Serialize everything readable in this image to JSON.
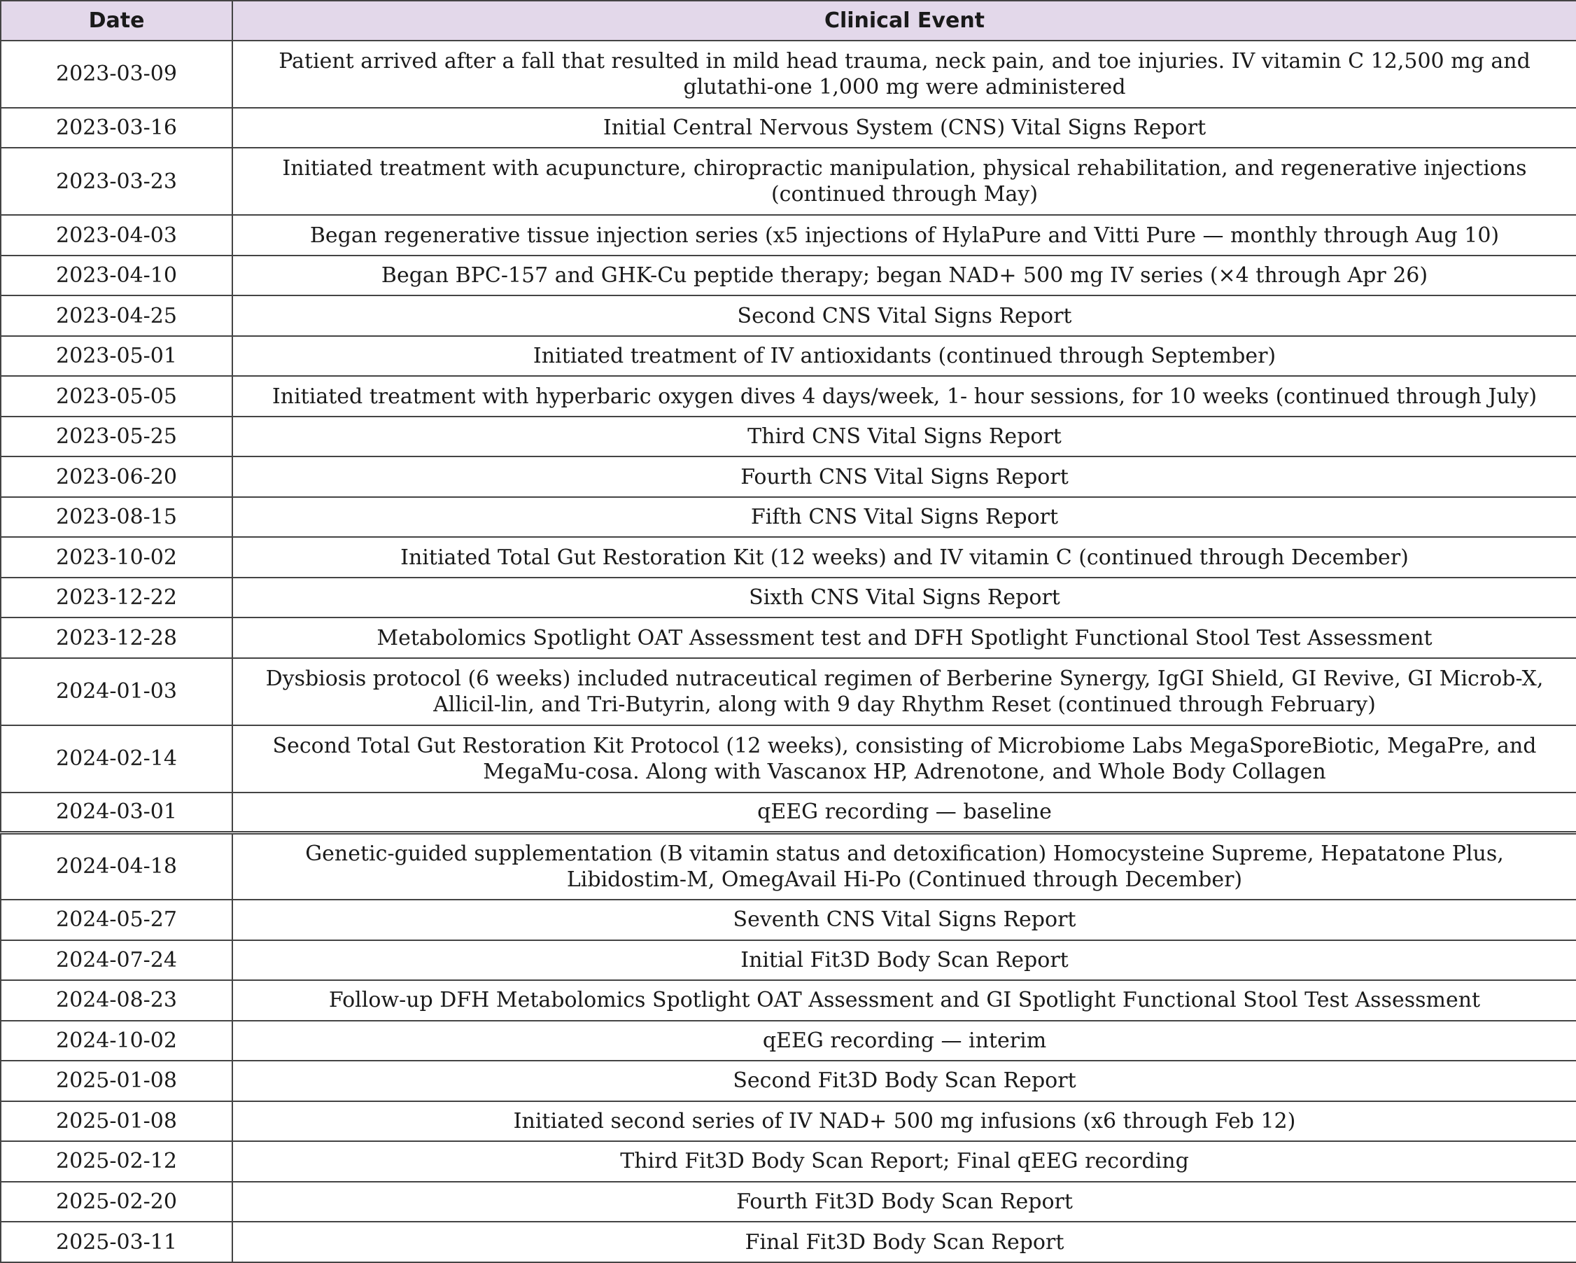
{
  "table": {
    "headers": {
      "date": "Date",
      "event": "Clinical Event"
    },
    "rows": [
      {
        "date": "2023-03-09",
        "event": "Patient arrived after a fall that resulted in mild head trauma, neck pain, and toe injuries. IV vitamin C 12,500 mg and glutathi-one 1,000 mg were administered"
      },
      {
        "date": "2023-03-16",
        "event": "Initial Central Nervous System (CNS) Vital Signs Report"
      },
      {
        "date": "2023-03-23",
        "event": "Initiated treatment with acupuncture, chiropractic manipulation, physical rehabilitation, and regenerative injections (continued through May)"
      },
      {
        "date": "2023-04-03",
        "event": "Began regenerative tissue injection series (x5 injections of HylaPure and Vitti Pure — monthly through Aug 10)"
      },
      {
        "date": "2023-04-10",
        "event": "Began BPC-157 and GHK-Cu peptide therapy; began NAD+ 500 mg IV series (×4 through Apr 26)"
      },
      {
        "date": "2023-04-25",
        "event": "Second CNS Vital Signs Report"
      },
      {
        "date": "2023-05-01",
        "event": "Initiated treatment of IV antioxidants (continued through September)"
      },
      {
        "date": "2023-05-05",
        "event": "Initiated treatment with hyperbaric oxygen dives 4 days/week, 1- hour sessions, for 10 weeks (continued through July)"
      },
      {
        "date": "2023-05-25",
        "event": "Third CNS Vital Signs Report"
      },
      {
        "date": "2023-06-20",
        "event": "Fourth CNS Vital Signs Report"
      },
      {
        "date": "2023-08-15",
        "event": "Fifth CNS Vital Signs Report"
      },
      {
        "date": "2023-10-02",
        "event": "Initiated Total Gut Restoration Kit (12 weeks) and IV vitamin C (continued through December)"
      },
      {
        "date": "2023-12-22",
        "event": "Sixth CNS Vital Signs Report"
      },
      {
        "date": "2023-12-28",
        "event": "Metabolomics Spotlight OAT Assessment test and DFH Spotlight Functional Stool Test Assessment"
      },
      {
        "date": "2024-01-03",
        "event": "Dysbiosis protocol (6 weeks) included nutraceutical regimen of Berberine Synergy, IgGI Shield, GI Revive, GI Microb-X, Allicil-lin, and Tri-Butyrin, along with 9 day Rhythm Reset (continued through February)"
      },
      {
        "date": "2024-02-14",
        "event": "Second Total Gut Restoration Kit Protocol (12 weeks), consisting of Microbiome Labs MegaSporeBiotic, MegaPre, and MegaMu-cosa. Along with Vascanox HP, Adrenotone, and Whole Body Collagen"
      },
      {
        "date": "2024-03-01",
        "event": "qEEG recording — baseline"
      },
      {
        "date": "2024-04-18",
        "event": "Genetic-guided supplementation (B vitamin status and detoxification) Homocysteine Supreme, Hepatatone Plus, Libidostim-M, OmegAvail Hi-Po (Continued through December)"
      },
      {
        "date": "2024-05-27",
        "event": "Seventh CNS Vital Signs Report"
      },
      {
        "date": "2024-07-24",
        "event": "Initial Fit3D Body Scan Report"
      },
      {
        "date": "2024-08-23",
        "event": "Follow-up DFH Metabolomics Spotlight OAT Assessment and GI Spotlight Functional Stool Test Assessment"
      },
      {
        "date": "2024-10-02",
        "event": "qEEG recording — interim"
      },
      {
        "date": "2025-01-08",
        "event": "Second Fit3D Body Scan Report"
      },
      {
        "date": "2025-01-08",
        "event": "Initiated second series of IV NAD+ 500 mg infusions (x6 through Feb 12)"
      },
      {
        "date": "2025-02-12",
        "event": "Third Fit3D Body Scan Report; Final qEEG recording"
      },
      {
        "date": "2025-02-20",
        "event": "Fourth Fit3D Body Scan Report"
      },
      {
        "date": "2025-03-11",
        "event": "Final Fit3D Body Scan Report"
      }
    ]
  },
  "colors": {
    "header_background": "#e3d8ea",
    "border": "#444444",
    "text": "#1a1a1a"
  }
}
